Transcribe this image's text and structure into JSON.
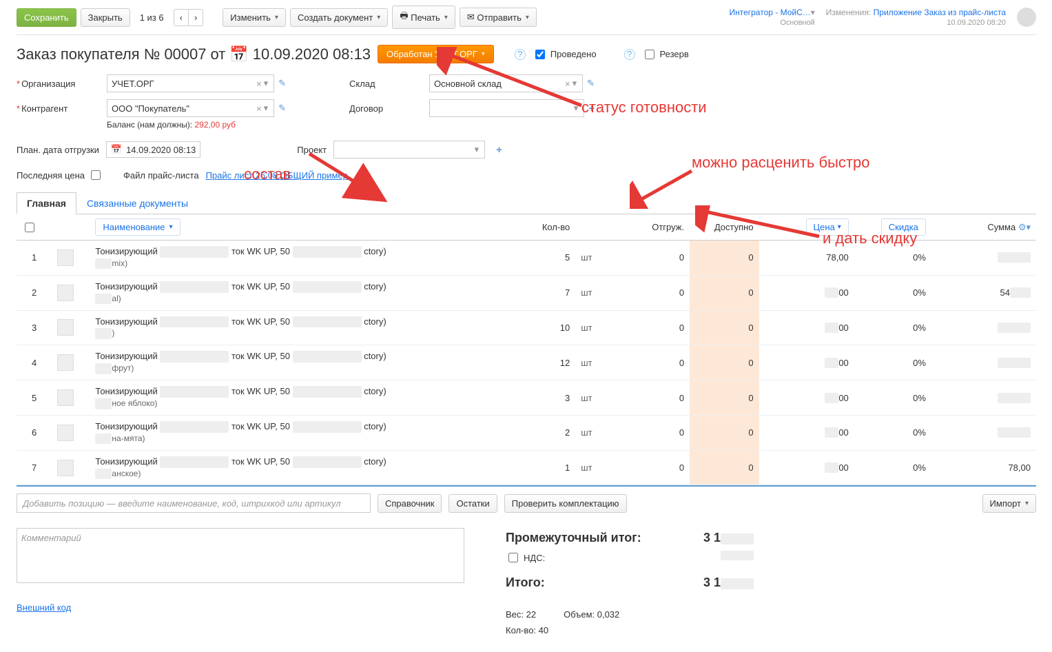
{
  "toolbar": {
    "save": "Сохранить",
    "close": "Закрыть",
    "pager": "1 из 6",
    "edit": "Изменить",
    "create_doc": "Создать документ",
    "print": "Печать",
    "send": "Отправить"
  },
  "header_right": {
    "integrator_label": "Интегратор - МойС…",
    "integrator_sub": "Основной",
    "changes_label": "Изменения:",
    "changes_link": "Приложение Заказ из прайс-листа",
    "changes_ts": "10.09.2020 08:20"
  },
  "title": {
    "prefix": "Заказ покупателя №",
    "number": "00007",
    "from": "от",
    "datetime": "10.09.2020 08:13",
    "status": "Обработан УЧЕТ.ОРГ",
    "processed": "Проведено",
    "reserve": "Резерв"
  },
  "form": {
    "org_label": "Организация",
    "org_value": "УЧЕТ.ОРГ",
    "counterparty_label": "Контрагент",
    "counterparty_value": "ООО \"Покупатель\"",
    "balance_label": "Баланс (нам должны):",
    "balance_value": "292,00 руб",
    "warehouse_label": "Склад",
    "warehouse_value": "Основной склад",
    "contract_label": "Договор",
    "contract_value": "",
    "plan_date_label": "План. дата отгрузки",
    "plan_date_value": "14.09.2020 08:13",
    "project_label": "Проект",
    "project_value": "",
    "last_price_label": "Последняя цена",
    "price_file_label": "Файл прайс-листа",
    "price_file_link": "Прайс лист 26.08 ОБЩИЙ  пример"
  },
  "tabs": {
    "main": "Главная",
    "related": "Связанные документы"
  },
  "grid": {
    "headers": {
      "name": "Наименование",
      "qty": "Кол-во",
      "shipped": "Отгруж.",
      "avail": "Доступно",
      "price": "Цена",
      "discount": "Скидка",
      "sum": "Сумма"
    },
    "rows": [
      {
        "n": "1",
        "name1": "Тонизирующий",
        "mid": "ток WK UP, 50",
        "end": "ctory)",
        "sub": "mix)",
        "qty": "5",
        "unit": "шт",
        "shipped": "0",
        "avail": "0",
        "price_pre": "78",
        "price_suf": ",00",
        "disc": "0%",
        "sum": ""
      },
      {
        "n": "2",
        "name1": "Тонизирующий",
        "mid": "ток WK UP, 50",
        "end": "ctory)",
        "sub": "al)",
        "qty": "7",
        "unit": "шт",
        "shipped": "0",
        "avail": "0",
        "price_pre": "",
        "price_suf": "00",
        "disc": "0%",
        "sum": "54"
      },
      {
        "n": "3",
        "name1": "Тонизирующий",
        "mid": "ток WK UP, 50",
        "end": "ctory)",
        "sub": ")",
        "qty": "10",
        "unit": "шт",
        "shipped": "0",
        "avail": "0",
        "price_pre": "",
        "price_suf": "00",
        "disc": "0%",
        "sum": ""
      },
      {
        "n": "4",
        "name1": "Тонизирующий",
        "mid": "ток WK UP, 50",
        "end": "ctory)",
        "sub": "фрут)",
        "qty": "12",
        "unit": "шт",
        "shipped": "0",
        "avail": "0",
        "price_pre": "",
        "price_suf": "00",
        "disc": "0%",
        "sum": ""
      },
      {
        "n": "5",
        "name1": "Тонизирующий",
        "mid": "ток WK UP, 50",
        "end": "ctory)",
        "sub": "ное яблоко)",
        "qty": "3",
        "unit": "шт",
        "shipped": "0",
        "avail": "0",
        "price_pre": "",
        "price_suf": "00",
        "disc": "0%",
        "sum": ""
      },
      {
        "n": "6",
        "name1": "Тонизирующий",
        "mid": "ток WK UP, 50",
        "end": "ctory)",
        "sub": "на-мята)",
        "qty": "2",
        "unit": "шт",
        "shipped": "0",
        "avail": "0",
        "price_pre": "",
        "price_suf": "00",
        "disc": "0%",
        "sum": ""
      },
      {
        "n": "7",
        "name1": "Тонизирующий",
        "mid": "ток WK UP, 50",
        "end": "ctory)",
        "sub": "анское)",
        "qty": "1",
        "unit": "шт",
        "shipped": "0",
        "avail": "0",
        "price_pre": "",
        "price_suf": "00",
        "disc": "0%",
        "sum": "78,00"
      }
    ],
    "add_placeholder": "Добавить позицию — введите наименование, код, штрихкод или артикул",
    "btn_catalog": "Справочник",
    "btn_stock": "Остатки",
    "btn_check": "Проверить комплектацию",
    "btn_import": "Импорт"
  },
  "bottom": {
    "comment_placeholder": "Комментарий",
    "subtotal_label": "Промежуточный итог:",
    "subtotal_value": "3 1",
    "nds_label": "НДС:",
    "total_label": "Итого:",
    "total_value": "3 1",
    "weight": "Вес: 22",
    "volume": "Объем: 0,032",
    "count": "Кол-во: 40",
    "ext_code": "Внешний код"
  },
  "annotations": {
    "status": "статус готовности",
    "composition": "состав",
    "price_fast": "можно расценить быстро",
    "discount": "и дать скидку"
  }
}
